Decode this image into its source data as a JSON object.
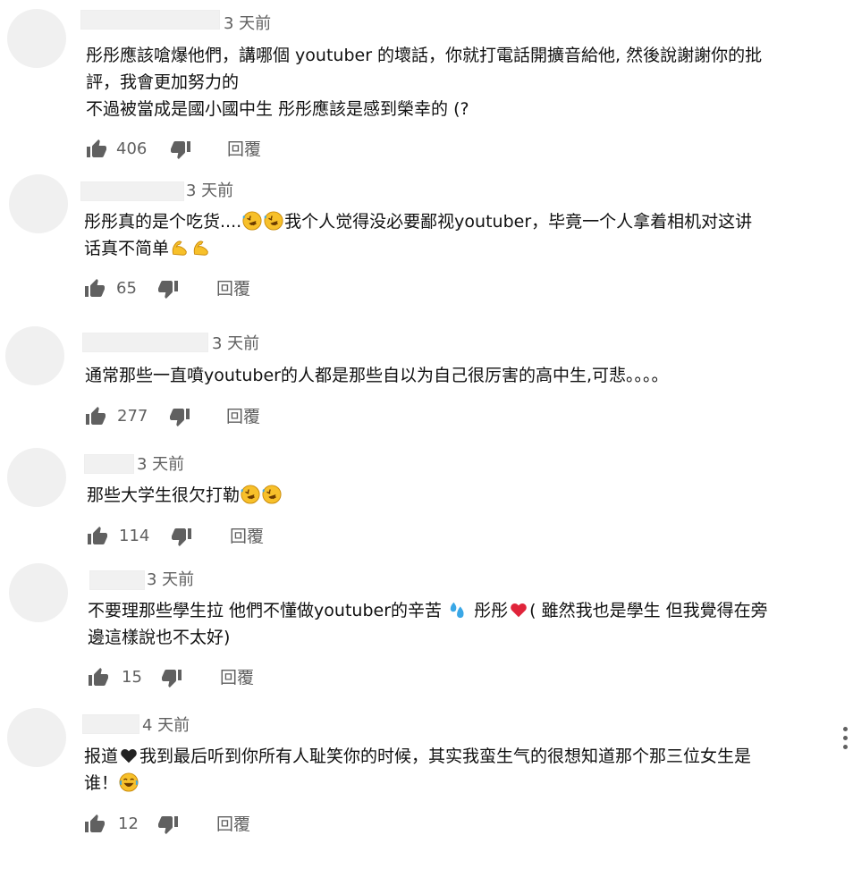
{
  "comments": [
    {
      "time": "3 天前",
      "lines": [
        "彤彤應該嗆爆他們，講哪個 youtuber 的壞話，你就打電話開擴音給他, 然後說謝謝你的批",
        "評，我會更加努力的",
        "不過被當成是國小國中生 彤彤應該是感到榮幸的 (?"
      ],
      "likes": "406",
      "reply_label": "回覆"
    },
    {
      "time": "3 天前",
      "line1_a": "彤彤真的是个吃货....",
      "line1_b": "我个人觉得没必要鄙视youtuber，毕竟一个人拿着相机对这讲",
      "line2": "话真不简单",
      "likes": "65",
      "reply_label": "回覆"
    },
    {
      "time": "3 天前",
      "lines": [
        "通常那些一直噴youtuber的人都是那些自以为自己很厉害的高中生,可悲。。。。"
      ],
      "likes": "277",
      "reply_label": "回覆"
    },
    {
      "time": "3 天前",
      "line1": "那些大学生很欠打勒",
      "likes": "114",
      "reply_label": "回覆"
    },
    {
      "time": "3 天前",
      "line1_a": "不要理那些學生拉 他們不懂做youtuber的辛苦",
      "line1_b": "彤彤",
      "line1_c": "( 雖然我也是學生 但我覺得在旁",
      "line2": "邊這樣說也不太好)",
      "likes": "15",
      "reply_label": "回覆"
    },
    {
      "time": "4 天前",
      "line1_a": "报道",
      "line1_b": "我到最后听到你所有人耻笑你的时候，其实我蛮生气的很想知道那个那三位女生是",
      "line2": "谁！",
      "likes": "12",
      "reply_label": "回覆"
    }
  ],
  "icons": {
    "like": "thumb-up-icon",
    "dislike": "thumb-down-icon",
    "more": "more-vert-icon",
    "laugh_emoji": "rolling-on-floor-laughing-emoji",
    "muscle_emoji": "flexed-biceps-emoji",
    "sweat_emoji": "sweat-droplets-emoji",
    "heart_emoji": "red-heart-emoji",
    "black_heart_emoji": "black-heart-emoji",
    "joy_emoji": "face-with-tears-of-joy-emoji"
  },
  "colors": {
    "text": "#111111",
    "meta": "#606060",
    "placeholder": "#f1f1f1",
    "emoji_yellow": "#f7c02a",
    "emoji_blue": "#3aa7e6",
    "emoji_red": "#e0243a"
  }
}
